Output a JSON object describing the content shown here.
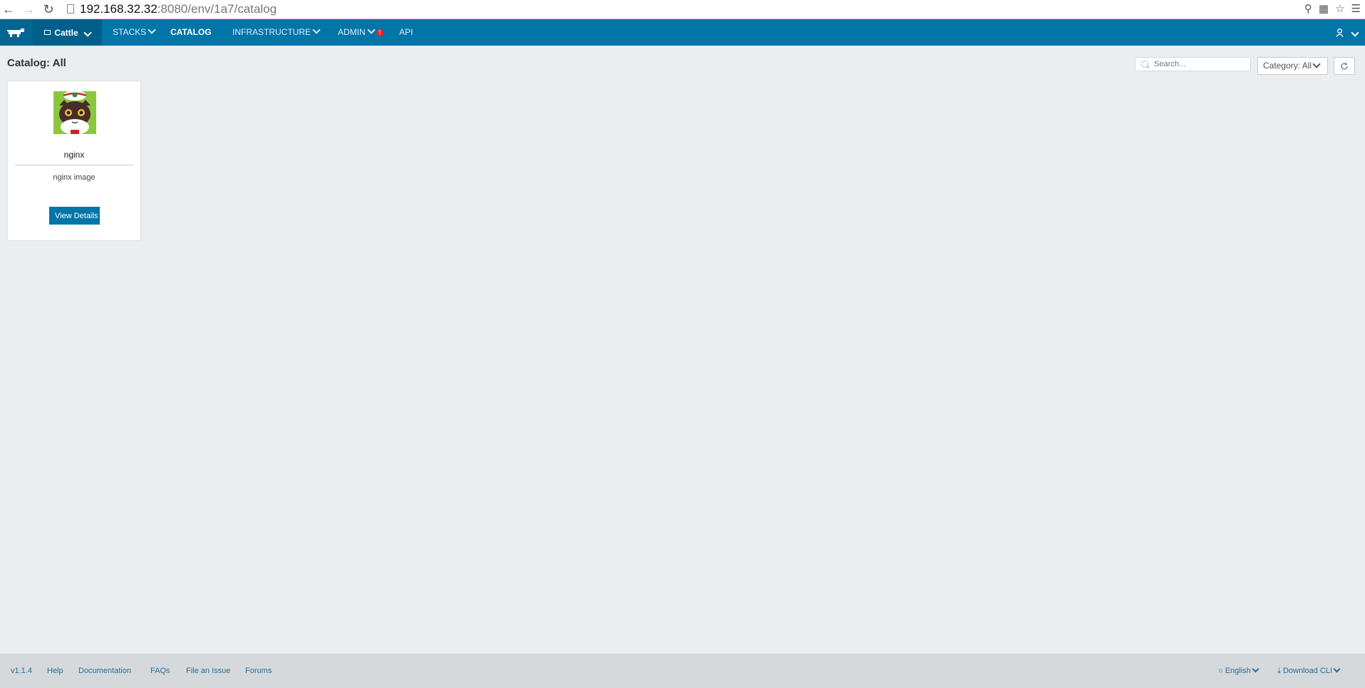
{
  "browser": {
    "url_host": "192.168.32.32",
    "url_rest": ":8080/env/1a7/catalog"
  },
  "header": {
    "environment": "Cattle",
    "nav": {
      "stacks": "STACKS",
      "catalog": "CATALOG",
      "infrastructure": "INFRASTRUCTURE",
      "admin": "ADMIN",
      "admin_badge": "!",
      "api": "API"
    }
  },
  "page": {
    "title": "Catalog: All",
    "search_placeholder": "Search...",
    "category_label": "Category: All"
  },
  "catalog_items": [
    {
      "name": "nginx",
      "description": "nginx image",
      "button_label": "View Details"
    }
  ],
  "footer": {
    "version": "v1.1.4",
    "help": "Help",
    "documentation": "Documentation",
    "faqs": "FAQs",
    "file_issue": "File an Issue",
    "forums": "Forums",
    "language": "English",
    "download_cli": "Download CLI"
  },
  "colors": {
    "header_blue": "#0075a8",
    "background": "#eaeef0",
    "footer": "#d5d9dc"
  }
}
